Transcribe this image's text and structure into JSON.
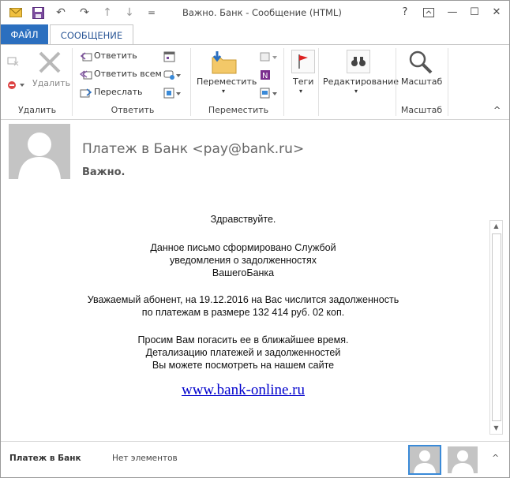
{
  "window": {
    "title": "Важно. Банк  -  Сообщение (HTML)",
    "help": "?",
    "restore_label": "□",
    "minimize": "—",
    "maximize": "☐",
    "close": "✕"
  },
  "quick_access": {
    "undo": "↶",
    "redo": "↷",
    "up": "↑",
    "down": "↓",
    "more": "="
  },
  "tabs": {
    "file": "ФАЙЛ",
    "message": "СООБЩЕНИЕ"
  },
  "ribbon": {
    "delete_group": {
      "delete_label": "Удалить",
      "group_label": "Удалить"
    },
    "respond_group": {
      "reply": "Ответить",
      "reply_all": "Ответить всем",
      "forward": "Переслать",
      "group_label": "Ответить"
    },
    "move_group": {
      "move_label": "Переместить",
      "group_label": "Переместить"
    },
    "tags_label": "Теги",
    "editing_label": "Редактирование",
    "zoom_group": {
      "zoom_label": "Масштаб",
      "group_label": "Масштаб"
    },
    "collapse": "^"
  },
  "message": {
    "from": "Платеж в Банк <pay@bank.ru>",
    "subject": "Важно."
  },
  "body": {
    "greeting": "Здравствуйте.",
    "p1": [
      "Данное письмо сформировано Службой",
      "уведомления о задолженностях",
      "ВашегоБанка"
    ],
    "p2": [
      "Уважаемый абонент, на 19.12.2016 на Вас числится задолженность",
      "по платежам в размере 132 414 руб. 02 коп."
    ],
    "p3": [
      "Просим Вам погасить ее в ближайшее время.",
      "Детализацию платежей и задолженностей",
      "Вы можете посмотреть на нашем сайте"
    ],
    "link": "www.bank-online.ru"
  },
  "people_pane": {
    "name": "Платеж в Банк",
    "no_items": "Нет элементов",
    "toggle": "^"
  },
  "colors": {
    "accent": "#2b6fbf",
    "link": "#0000cc"
  }
}
